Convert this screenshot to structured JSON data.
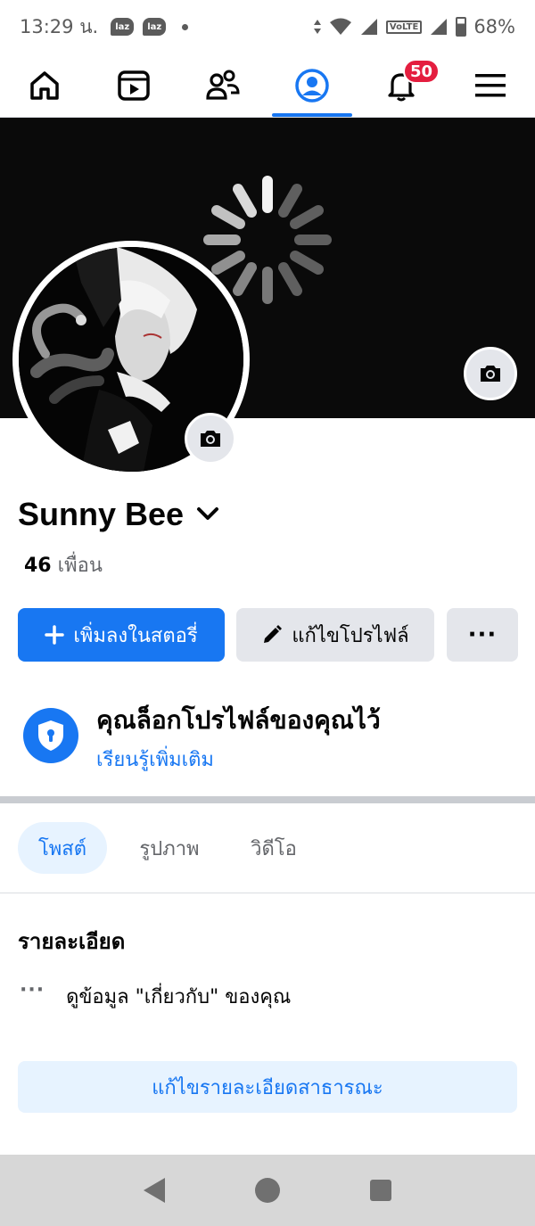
{
  "status_bar": {
    "time": "13:29 น.",
    "app_badges": [
      "laz",
      "laz"
    ],
    "battery": "68%",
    "network_label": "VoLTE"
  },
  "top_nav": {
    "items": [
      {
        "icon": "home-icon",
        "active": false
      },
      {
        "icon": "video-icon",
        "active": false
      },
      {
        "icon": "friends-icon",
        "active": false
      },
      {
        "icon": "profile-icon",
        "active": true
      },
      {
        "icon": "bell-icon",
        "active": false,
        "badge": "50"
      },
      {
        "icon": "menu-icon",
        "active": false
      }
    ]
  },
  "profile": {
    "name": "Sunny Bee",
    "friends_count": "46",
    "friends_label": "เพื่อน"
  },
  "actions": {
    "add_story": "เพิ่มลงในสตอรี่",
    "edit_profile": "แก้ไขโปรไฟล์",
    "more": "···"
  },
  "lock_notice": {
    "title": "คุณล็อกโปรไฟล์ของคุณไว้",
    "link": "เรียนรู้เพิ่มเติม"
  },
  "tabs": [
    {
      "label": "โพสต์",
      "active": true
    },
    {
      "label": "รูปภาพ",
      "active": false
    },
    {
      "label": "วิดีโอ",
      "active": false
    }
  ],
  "details": {
    "title": "รายละเอียด",
    "about_item": "ดูข้อมูล \"เกี่ยวกับ\" ของคุณ",
    "edit_public": "แก้ไขรายละเอียดสาธารณะ"
  },
  "colors": {
    "brand_blue": "#1877f2",
    "badge_red": "#e41e3f",
    "light_gray": "#e4e6eb",
    "light_blue": "#e7f3ff"
  }
}
